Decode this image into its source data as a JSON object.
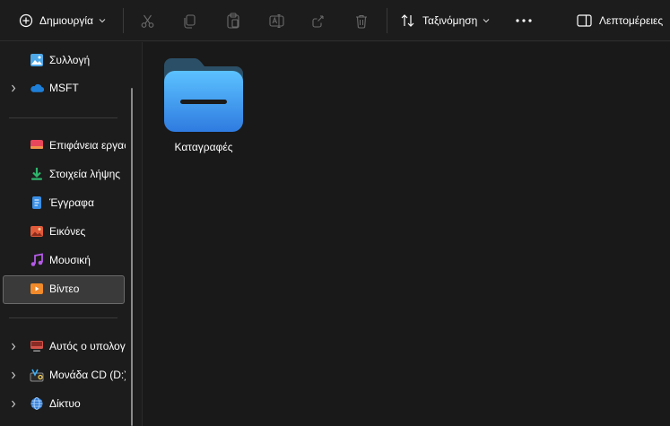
{
  "toolbar": {
    "new_label": "Δημιουργία",
    "sort_label": "Ταξινόμηση",
    "details_label": "Λεπτομέρειες",
    "icons": [
      "plus-circle-icon",
      "cut-icon",
      "copy-icon",
      "paste-icon",
      "rename-icon",
      "share-icon",
      "delete-icon",
      "sort-icon",
      "more-icon",
      "details-pane-icon"
    ]
  },
  "sidebar": {
    "items": [
      {
        "label": "Συλλογή",
        "icon": "gallery-icon"
      },
      {
        "label": "MSFT",
        "icon": "onedrive-icon",
        "expandable": true
      },
      {
        "label": "Επιφάνεια εργασίας",
        "icon": "desktop-icon"
      },
      {
        "label": "Στοιχεία λήψης",
        "icon": "downloads-icon"
      },
      {
        "label": "Έγγραφα",
        "icon": "documents-icon"
      },
      {
        "label": "Εικόνες",
        "icon": "pictures-icon"
      },
      {
        "label": "Μουσική",
        "icon": "music-icon"
      },
      {
        "label": "Βίντεο",
        "icon": "videos-icon",
        "selected": true
      },
      {
        "label": "Αυτός ο υπολογιστής",
        "icon": "this-pc-icon",
        "expandable": true
      },
      {
        "label": "Μονάδα CD (D:)",
        "icon": "cd-drive-icon",
        "expandable": true
      },
      {
        "label": "Δίκτυο",
        "icon": "network-icon",
        "expandable": true
      }
    ]
  },
  "main": {
    "items": [
      {
        "label": "Καταγραφές",
        "type": "folder"
      }
    ]
  },
  "colors": {
    "background": "#1c1c1c",
    "selected_item": "#3a3a3a",
    "folder_blue": "#3fb0f5"
  }
}
